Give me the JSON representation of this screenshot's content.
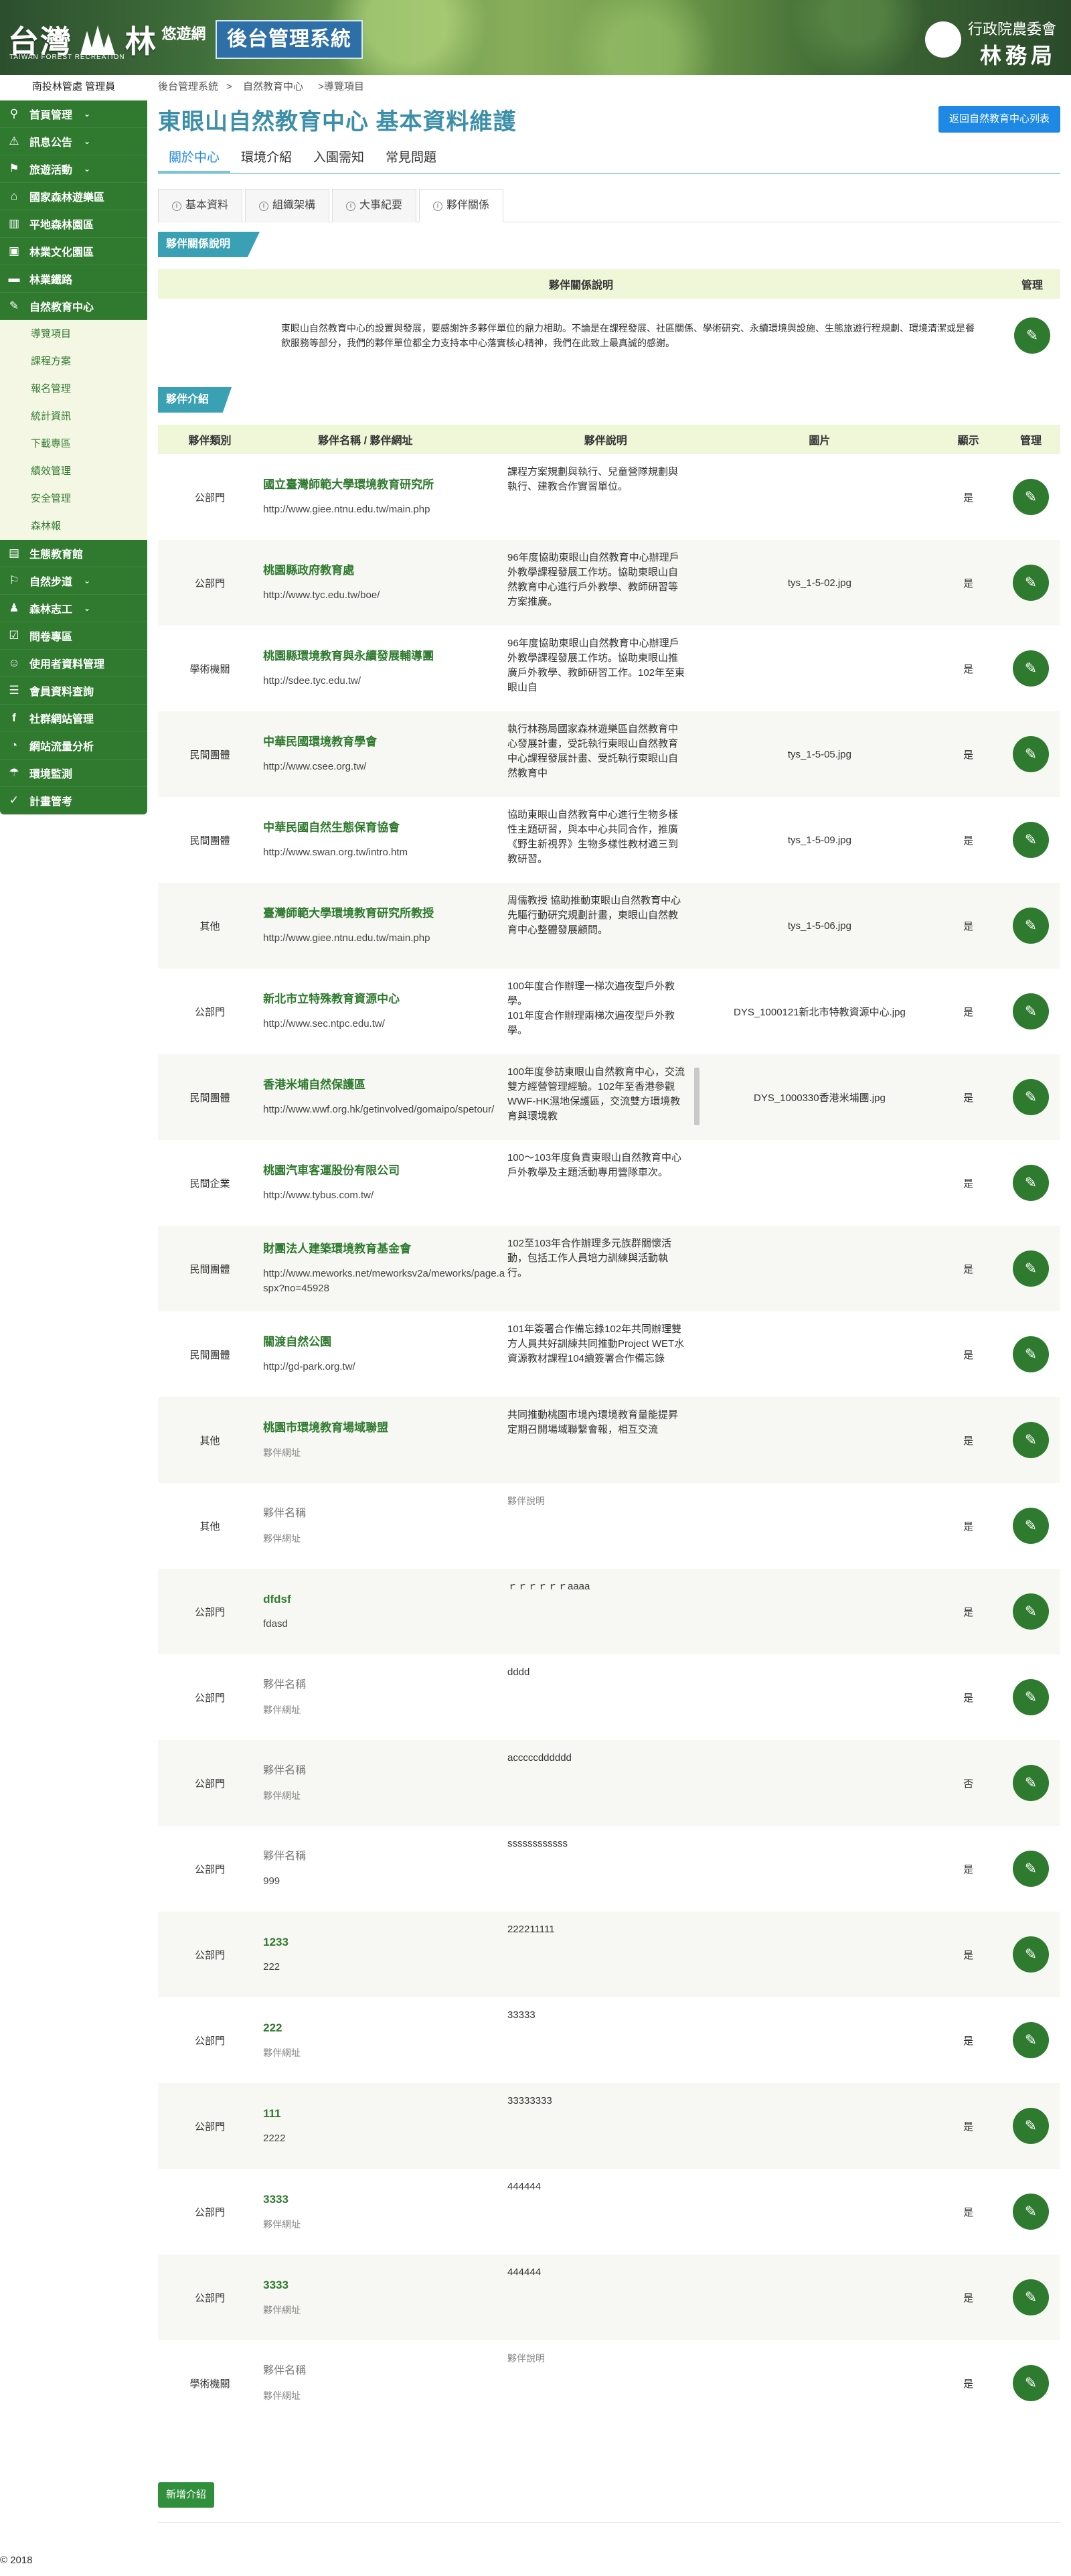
{
  "header": {
    "logo_main": "台灣",
    "logo_forest": "林",
    "logo_suffix": "悠遊網",
    "logo_en": "TAIWAN FOREST RECREATION",
    "system_name": "後台管理系統",
    "agency_line1": "行政院農委會",
    "agency_line2": "林務局"
  },
  "user": "南投林管處 管理員",
  "sidebar": {
    "items": [
      {
        "label": "首頁管理",
        "icon": "⚲",
        "chevron": true
      },
      {
        "label": "訊息公告",
        "icon": "⚠",
        "chevron": true
      },
      {
        "label": "旅遊活動",
        "icon": "⚑",
        "chevron": true
      },
      {
        "label": "國家森林遊樂區",
        "icon": "⌂",
        "chevron": false
      },
      {
        "label": "平地森林園區",
        "icon": "▥",
        "chevron": false
      },
      {
        "label": "林業文化園區",
        "icon": "▣",
        "chevron": false
      },
      {
        "label": "林業鐵路",
        "icon": "▬",
        "chevron": false
      },
      {
        "label": "自然教育中心",
        "icon": "✎",
        "chevron": true
      }
    ],
    "sub_items": [
      "導覽項目",
      "課程方案",
      "報名管理",
      "統計資訊",
      "下載專區",
      "績效管理",
      "安全管理",
      "森林報"
    ],
    "items_after": [
      {
        "label": "生態教育館",
        "icon": "▤",
        "chevron": false
      },
      {
        "label": "自然步道",
        "icon": "⚐",
        "chevron": true
      },
      {
        "label": "森林志工",
        "icon": "♟",
        "chevron": true
      },
      {
        "label": "問卷專區",
        "icon": "☑",
        "chevron": false
      },
      {
        "label": "使用者資料管理",
        "icon": "☺",
        "chevron": false
      },
      {
        "label": "會員資料查詢",
        "icon": "☰",
        "chevron": false
      },
      {
        "label": "社群網站管理",
        "icon": "f",
        "chevron": false
      },
      {
        "label": "網站流量分析",
        "icon": "◔",
        "chevron": false
      },
      {
        "label": "環境監測",
        "icon": "☂",
        "chevron": false
      },
      {
        "label": "計畫管考",
        "icon": "✓",
        "chevron": false
      }
    ]
  },
  "breadcrumb": [
    "後台管理系統",
    "自然教育中心",
    ">導覽項目"
  ],
  "page_title": "東眼山自然教育中心  基本資料維護",
  "back_button": "返回自然教育中心列表",
  "tabs_main": [
    "關於中心",
    "環境介紹",
    "入園需知",
    "常見問題"
  ],
  "tabs_sub": [
    "基本資料",
    "組織架構",
    "大事紀要",
    "夥伴關係"
  ],
  "relation_section": {
    "tag": "夥伴關係說明",
    "col_desc": "夥伴關係說明",
    "col_manage": "管理",
    "text": "東眼山自然教育中心的設置與發展，要感謝許多夥伴單位的鼎力相助。不論是在課程發展、社區關係、學術研究、永續環境與設施、生態旅遊行程規劃、環境清潔或是餐飲服務等部分，我們的夥伴單位都全力支持本中心落實核心精神，我們在此致上最真誠的感謝。"
  },
  "partner_section": {
    "tag": "夥伴介紹",
    "columns": [
      "夥伴類別",
      "夥伴名稱 / 夥伴網址",
      "夥伴說明",
      "圖片",
      "顯示",
      "管理"
    ],
    "rows": [
      {
        "type": "公部門",
        "name": "國立臺灣師範大學環境教育研究所",
        "url": "http://www.giee.ntnu.edu.tw/main.php",
        "desc": "課程方案規劃與執行、兒童營隊規劃與執行、建教合作實習單位。",
        "image": "",
        "show": "是",
        "ph": false
      },
      {
        "type": "公部門",
        "name": "桃園縣政府教育處",
        "url": "http://www.tyc.edu.tw/boe/",
        "desc": "96年度協助東眼山自然教育中心辦理戶外教學課程發展工作坊。協助東眼山自然教育中心進行戶外教學、教師研習等方案推廣。",
        "image": "tys_1-5-02.jpg",
        "show": "是",
        "ph": false
      },
      {
        "type": "學術機關",
        "name": "桃園縣環境教育與永續發展輔導團",
        "url": "http://sdee.tyc.edu.tw/",
        "desc": "96年度協助東眼山自然教育中心辦理戶外教學課程發展工作坊。協助東眼山推廣戶外教學、教師研習工作。102年至東眼山自",
        "image": "",
        "show": "是",
        "ph": false
      },
      {
        "type": "民間團體",
        "name": "中華民國環境教育學會",
        "url": "http://www.csee.org.tw/",
        "desc": "執行林務局國家森林遊樂區自然教育中心發展計畫，受託執行東眼山自然教育中心課程發展計畫、受託執行東眼山自然教育中",
        "image": "tys_1-5-05.jpg",
        "show": "是",
        "ph": false
      },
      {
        "type": "民間團體",
        "name": "中華民國自然生態保育協會",
        "url": "http://www.swan.org.tw/intro.htm",
        "desc": "協助東眼山自然教育中心進行生物多樣性主題研習，與本中心共同合作，推廣《野生新視界》生物多樣性教材適三到教研習。",
        "image": "tys_1-5-09.jpg",
        "show": "是",
        "ph": false
      },
      {
        "type": "其他",
        "name": "臺灣師範大學環境教育研究所教授",
        "url": "http://www.giee.ntnu.edu.tw/main.php",
        "desc": "周儒教授 協助推動東眼山自然教育中心先驅行動研究規劃計畫，東眼山自然教育中心整體發展顧問。",
        "image": "tys_1-5-06.jpg",
        "show": "是",
        "ph": false
      },
      {
        "type": "公部門",
        "name": "新北市立特殊教育資源中心",
        "url": "http://www.sec.ntpc.edu.tw/",
        "desc": "100年度合作辦理一梯次遍夜型戶外教學。\n101年度合作辦理兩梯次遍夜型戶外教學。",
        "image": "DYS_1000121新北市特教資源中心.jpg",
        "show": "是",
        "ph": false
      },
      {
        "type": "民間團體",
        "name": "香港米埔自然保護區",
        "url": "http://www.wwf.org.hk/getinvolved/gomaipo/spetour/",
        "desc": "100年度參訪東眼山自然教育中心，交流雙方經營管理經驗。102年至香港參觀WWF-HK濕地保護區，交流雙方環境教育與環境教",
        "image": "DYS_1000330香港米埔團.jpg",
        "show": "是",
        "ph": false
      },
      {
        "type": "民間企業",
        "name": "桃園汽車客運股份有限公司",
        "url": "http://www.tybus.com.tw/",
        "desc": "100～103年度負責東眼山自然教育中心戶外教學及主題活動專用營隊車次。",
        "image": "",
        "show": "是",
        "ph": false
      },
      {
        "type": "民間團體",
        "name": "財團法人建築環境教育基金會",
        "url": "http://www.meworks.net/meworksv2a/meworks/page.aspx?no=45928",
        "desc": "102至103年合作辦理多元族群關懷活動，包括工作人員培力訓練與活動執行。",
        "image": "",
        "show": "是",
        "ph": false
      },
      {
        "type": "民間團體",
        "name": "關渡自然公園",
        "url": "http://gd-park.org.tw/",
        "desc": "101年簽署合作備忘錄102年共同辦理雙方人員共好訓練共同推動Project WET水資源教材課程104續簽署合作備忘錄",
        "image": "",
        "show": "是",
        "ph": false
      },
      {
        "type": "其他",
        "name": "桃園市環境教育場域聯盟",
        "url": "夥伴網址",
        "url_ph": true,
        "desc": "共同推動桃園市境內環境教育量能提昇定期召開場域聯繫會報，相互交流",
        "image": "",
        "show": "是",
        "ph": false
      },
      {
        "type": "其他",
        "name": "夥伴名稱",
        "url": "夥伴網址",
        "url_ph": true,
        "desc": "夥伴說明",
        "desc_ph": true,
        "image": "",
        "show": "是",
        "ph": true
      },
      {
        "type": "公部門",
        "name": "dfdsf",
        "url": "fdasd",
        "desc": "ｒｒｒｒｒｒaaaa",
        "image": "",
        "show": "是",
        "ph": false
      },
      {
        "type": "公部門",
        "name": "夥伴名稱",
        "url": "夥伴網址",
        "url_ph": true,
        "desc": "dddd",
        "image": "",
        "show": "是",
        "ph": true
      },
      {
        "type": "公部門",
        "name": "夥伴名稱",
        "url": "夥伴網址",
        "url_ph": true,
        "desc": "acccccdddddd",
        "image": "",
        "show": "否",
        "ph": true
      },
      {
        "type": "公部門",
        "name": "夥伴名稱",
        "url": "999",
        "desc": "ssssssssssss",
        "image": "",
        "show": "是",
        "ph": true
      },
      {
        "type": "公部門",
        "name": "1233",
        "url": "222",
        "desc": "222211111",
        "image": "",
        "show": "是",
        "ph": false
      },
      {
        "type": "公部門",
        "name": "222",
        "url": "夥伴網址",
        "url_ph": true,
        "desc": "33333",
        "image": "",
        "show": "是",
        "ph": false
      },
      {
        "type": "公部門",
        "name": "111",
        "url": "2222",
        "desc": "33333333",
        "image": "",
        "show": "是",
        "ph": false
      },
      {
        "type": "公部門",
        "name": "3333",
        "url": "夥伴網址",
        "url_ph": true,
        "desc": "444444",
        "image": "",
        "show": "是",
        "ph": false
      },
      {
        "type": "公部門",
        "name": "3333",
        "url": "夥伴網址",
        "url_ph": true,
        "desc": "444444",
        "image": "",
        "show": "是",
        "ph": false
      },
      {
        "type": "學術機關",
        "name": "夥伴名稱",
        "url": "夥伴網址",
        "url_ph": true,
        "desc": "夥伴說明",
        "desc_ph": true,
        "image": "",
        "show": "是",
        "ph": true
      }
    ]
  },
  "add_button": "新增介紹",
  "copyright": "© 2018",
  "colors": {
    "brand_green": "#2f7a2f",
    "accent_blue": "#1e88e5",
    "title_teal": "#3c8fa8",
    "header_band": "#f0f6d8"
  }
}
